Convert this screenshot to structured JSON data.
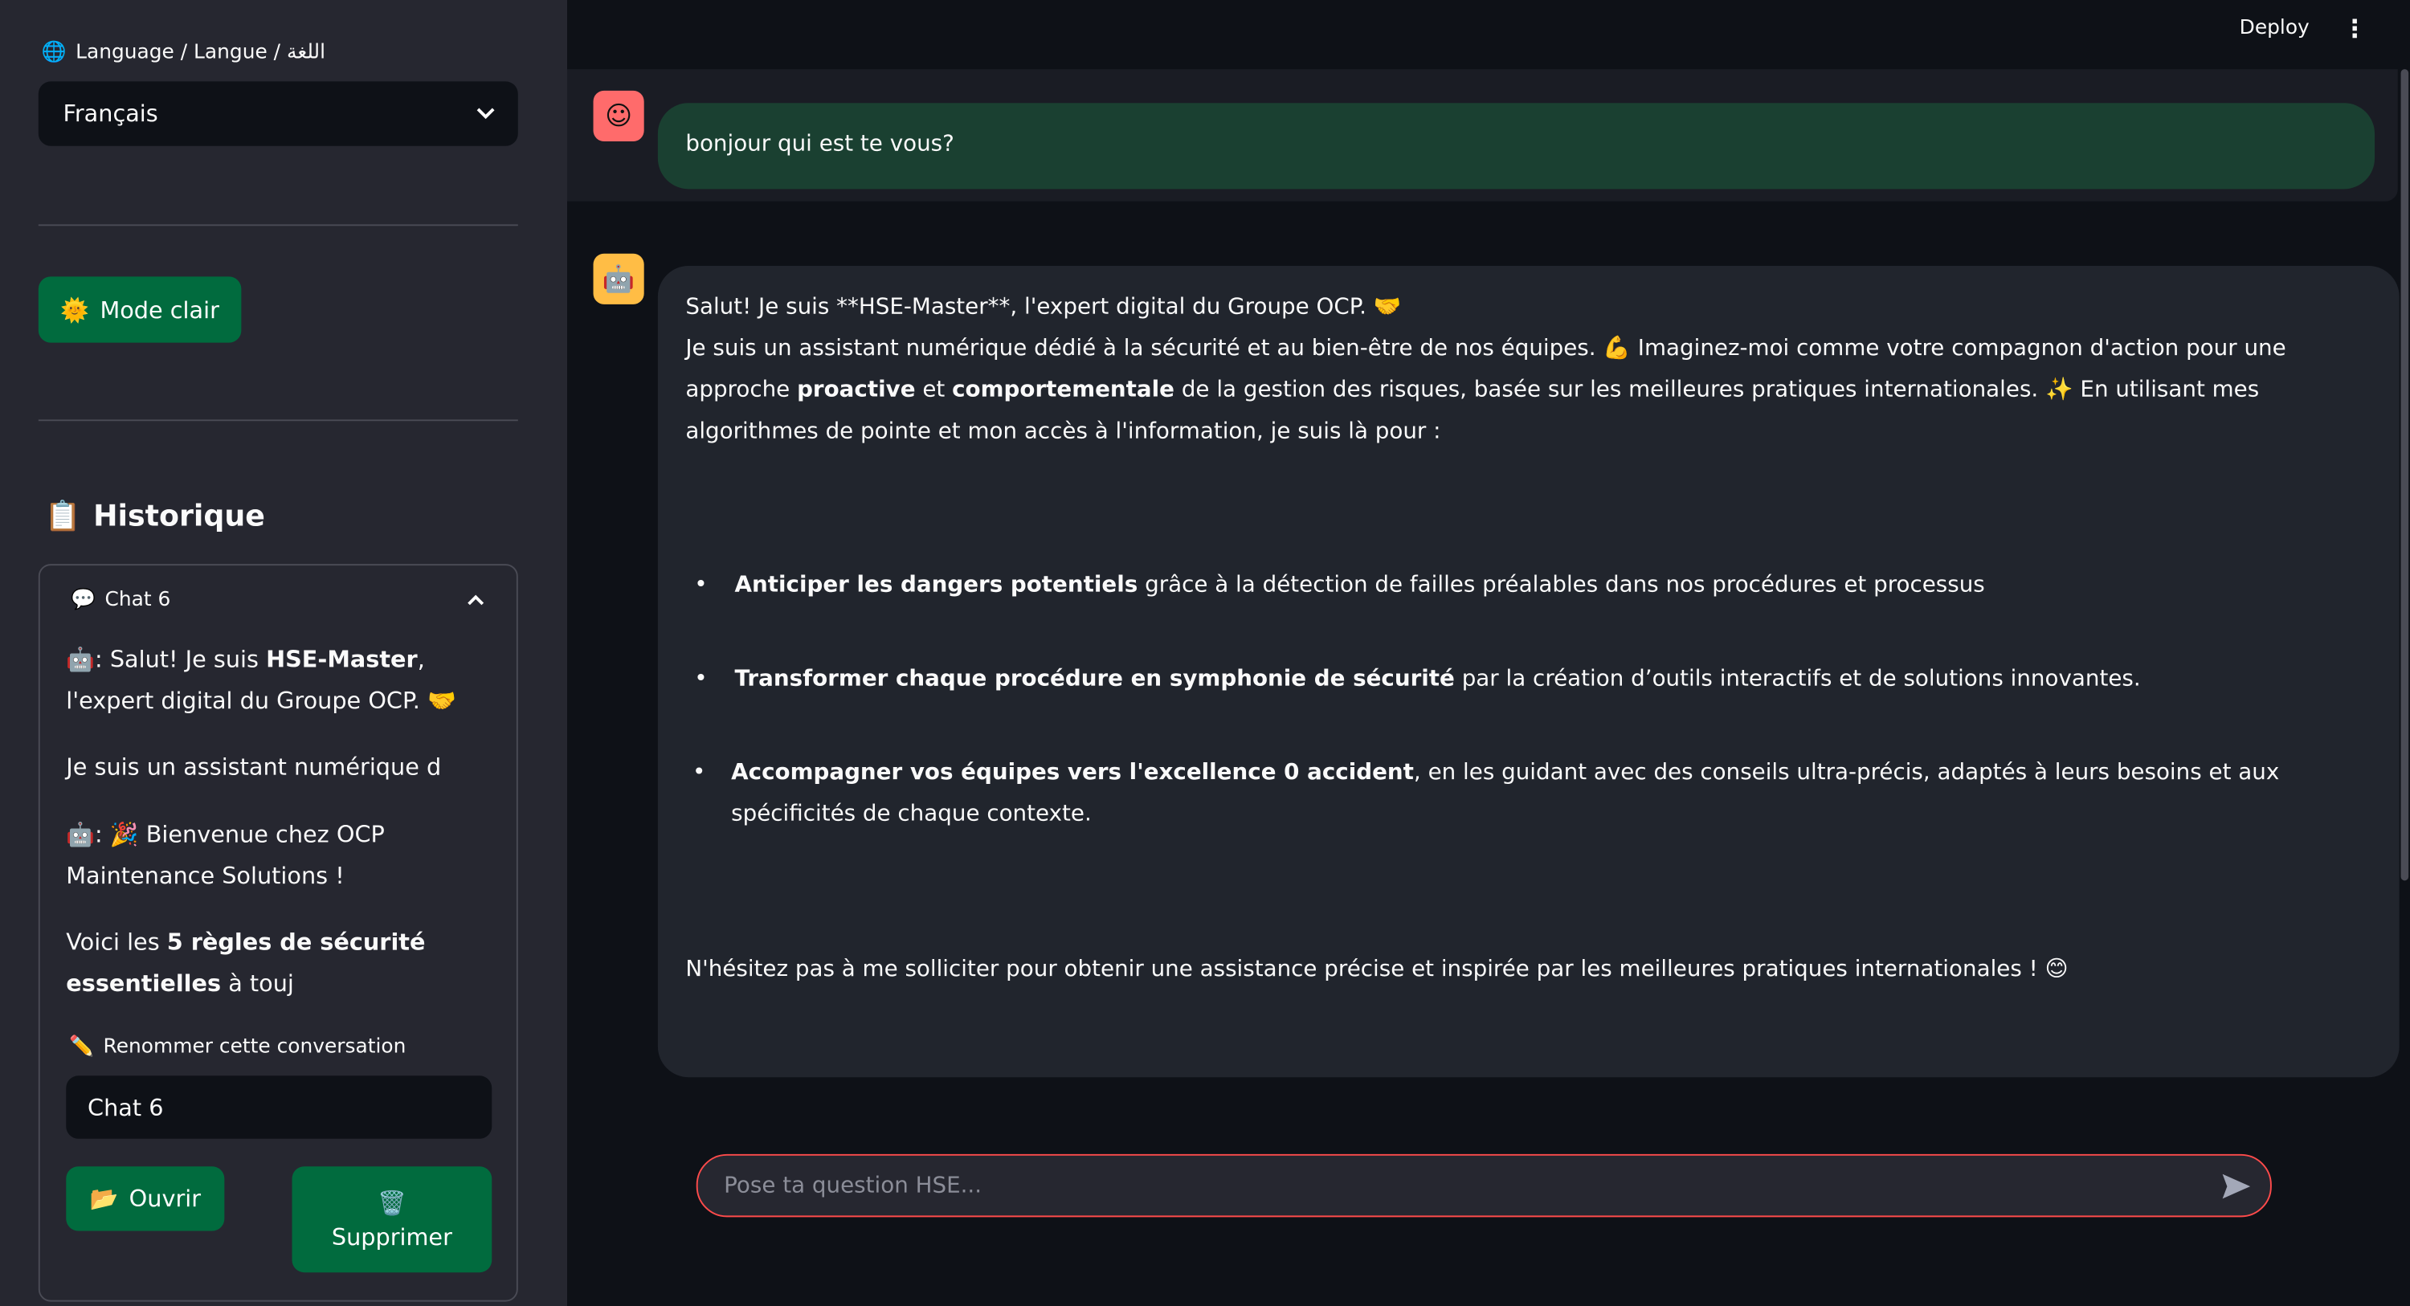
{
  "sidebar": {
    "language_label": "Language / Langue / اللغة",
    "language_icon": "globe-icon",
    "language_value": "Français",
    "theme_button": "Mode clair",
    "theme_icon": "smiling-sun-icon",
    "history_title": "Historique",
    "history_icon": "clipboard-icon",
    "expander": {
      "title": "Chat 6",
      "preview": {
        "line1_prefix": ": Salut! Je suis ",
        "line1_bold": "HSE-Master",
        "line1_suffix": ", l'expert digital du Groupe OCP.",
        "line2": "Je suis un assistant numérique d",
        "line3": "Bienvenue chez OCP Maintenance Solutions !",
        "line4_prefix": "Voici les ",
        "line4_bold": "5 règles de sécurité essentielles",
        "line4_suffix": " à touj"
      },
      "rename_label": "Renommer cette conversation",
      "rename_value": "Chat 6",
      "open_button": "Ouvrir",
      "delete_button": "Supprimer"
    }
  },
  "header": {
    "deploy": "Deploy"
  },
  "messages": {
    "user": "bonjour qui est te vous?",
    "assistant": {
      "p1": "Salut! Je suis **HSE-Master**, l'expert digital du Groupe OCP.",
      "p2_a": "Je suis un assistant numérique dédié à la sécurité et au bien-être de nos équipes.",
      "p2_b": "Imaginez-moi comme votre compagnon d'action pour une approche",
      "p2_bold1": "proactive",
      "p2_et": " et ",
      "p2_bold2": "comportementale",
      "p2_c": " de la gestion des risques, basée sur les meilleures pratiques internationales.",
      "p2_d": "En utilisant mes algorithmes de pointe et mon accès à l'information, je suis là pour :",
      "bullets": [
        {
          "bold": "Anticiper les dangers potentiels",
          "text": " grâce à la détection de failles préalables dans nos procédures et processus"
        },
        {
          "bold": "Transformer chaque procédure en symphonie de sécurité",
          "text": " par la création d’outils interactifs et de solutions innovantes."
        },
        {
          "bold": "Accompagner vos équipes vers l'excellence 0 accident",
          "text": ", en les guidant avec des conseils ultra-précis, adaptés à leurs besoins et aux spécificités de chaque contexte."
        }
      ],
      "closing": "N'hésitez pas à me solliciter pour obtenir une assistance précise et inspirée par les meilleures pratiques internationales !"
    }
  },
  "input": {
    "placeholder": "Pose ta question HSE..."
  },
  "colors": {
    "primary_button": "#016b3e",
    "accent": "#ff4b4b",
    "user_bubble": "#1a4031",
    "assistant_bubble": "#21252d",
    "user_avatar": "#ff6b6b",
    "bot_avatar": "#ffbd45"
  }
}
